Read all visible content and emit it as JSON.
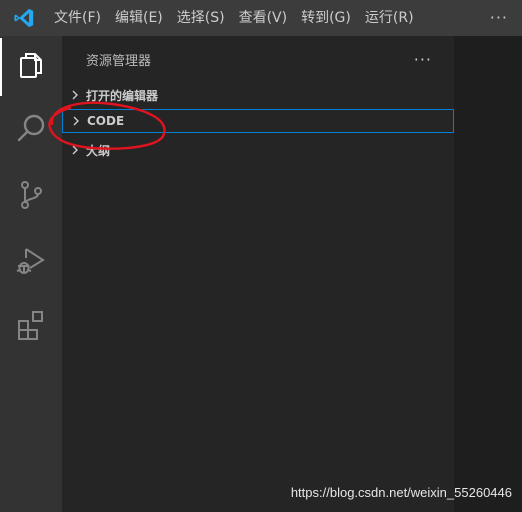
{
  "menubar": {
    "logo_icon": "vscode-logo-icon",
    "items": [
      {
        "label": "文件(F)"
      },
      {
        "label": "编辑(E)"
      },
      {
        "label": "选择(S)"
      },
      {
        "label": "查看(V)"
      },
      {
        "label": "转到(G)"
      },
      {
        "label": "运行(R)"
      }
    ],
    "more_label": "···"
  },
  "activitybar": {
    "items": [
      {
        "icon": "files-explorer-icon",
        "active": true
      },
      {
        "icon": "search-icon",
        "active": false
      },
      {
        "icon": "source-control-icon",
        "active": false
      },
      {
        "icon": "run-debug-icon",
        "active": false
      },
      {
        "icon": "extensions-icon",
        "active": false
      }
    ]
  },
  "sidebar": {
    "title": "资源管理器",
    "more_label": "···",
    "sections": [
      {
        "label": "打开的编辑器",
        "expanded": false,
        "focused": false
      },
      {
        "label": "CODE",
        "expanded": false,
        "focused": true
      },
      {
        "label": "大纲",
        "expanded": false,
        "focused": false
      }
    ]
  },
  "colors": {
    "menubar_bg": "#3c3c3c",
    "activitybar_bg": "#333333",
    "sidebar_bg": "#252526",
    "editor_bg": "#1e1e1e",
    "focus_border": "#007fd4",
    "logo_accent": "#23a9f2",
    "annotation_red": "#e0141e"
  },
  "watermark": "https://blog.csdn.net/weixin_55260446"
}
